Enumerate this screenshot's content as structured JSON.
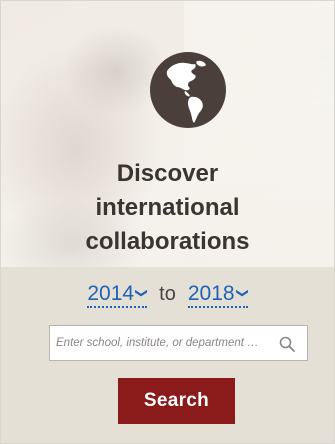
{
  "hero": {
    "headline_lines": [
      "Discover",
      "international",
      "collaborations"
    ],
    "globe_icon": "globe-americas-icon"
  },
  "date_range": {
    "start_year": "2014",
    "separator": "to",
    "end_year": "2018",
    "dropdown_icon": "chevron-down-icon"
  },
  "search": {
    "placeholder": "Enter school, institute, or department …",
    "value": "",
    "icon": "search-icon",
    "button_label": "Search"
  },
  "colors": {
    "accent": "#8b1a1a",
    "link": "#1f63b4",
    "headline": "#3b3432",
    "panel": "#e4e0d6",
    "globe": "#4a3f3b"
  }
}
